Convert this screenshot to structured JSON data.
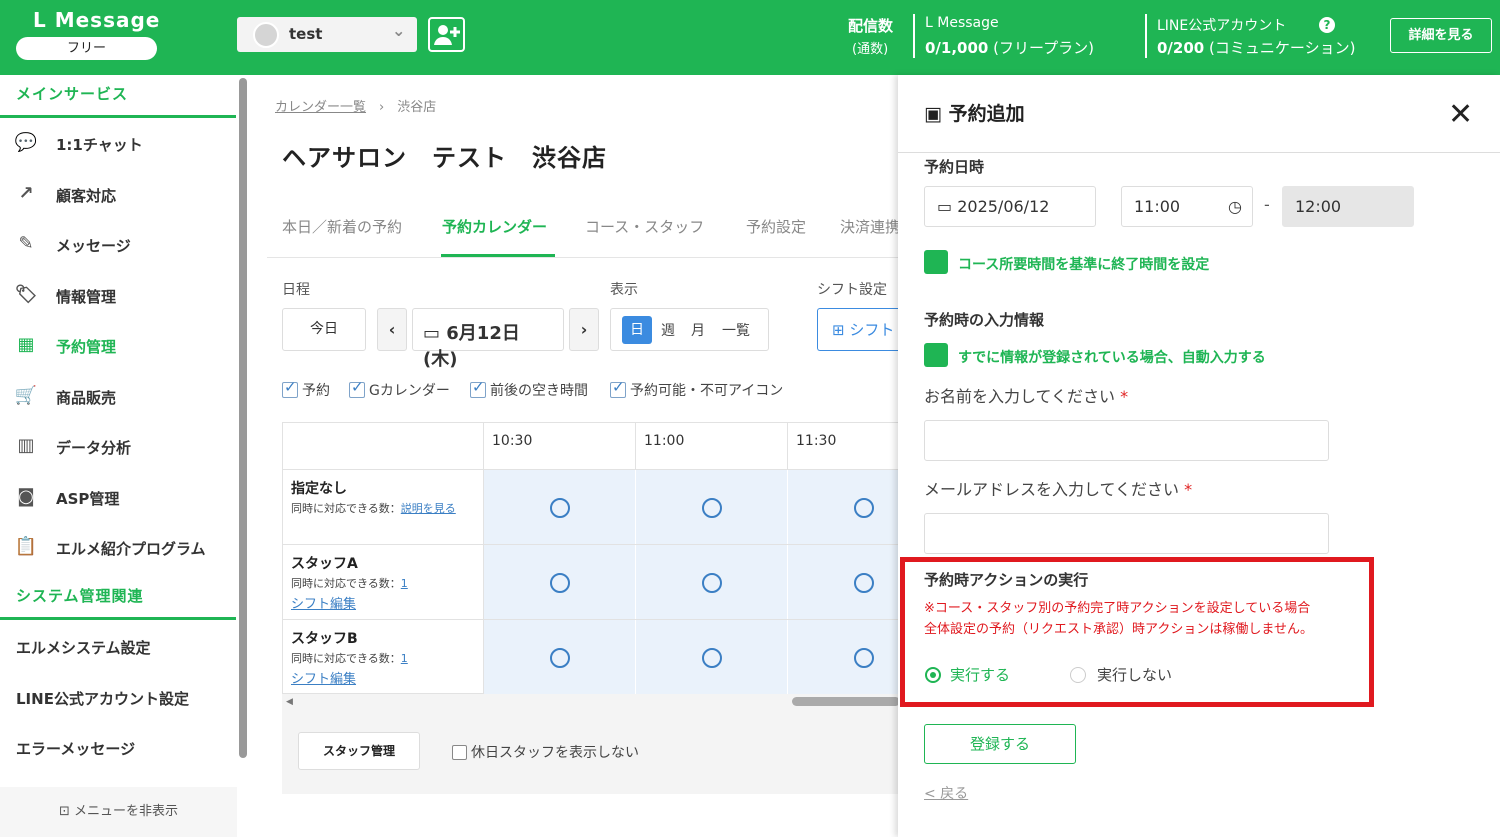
{
  "header": {
    "logo": "L Message",
    "plan": "フリー",
    "account_name": "test",
    "delivery_label": "配信数",
    "delivery_sub": "(通数)",
    "lm_title": "L Message",
    "lm_count": "0/1,000",
    "lm_plan": "(フリープラン)",
    "line_title": "LINE公式アカウント",
    "line_count": "0/200",
    "line_plan": "(コミュニケーション)",
    "detail_btn": "詳細を見る"
  },
  "sidebar": {
    "main_section": "メインサービス",
    "items": [
      {
        "label": "1:1チャット",
        "icon": "chat-icon"
      },
      {
        "label": "顧客対応",
        "icon": "arrow-icon"
      },
      {
        "label": "メッセージ",
        "icon": "edit-icon"
      },
      {
        "label": "情報管理",
        "icon": "tag-icon"
      },
      {
        "label": "予約管理",
        "icon": "calendar-icon"
      },
      {
        "label": "商品販売",
        "icon": "cart-icon"
      },
      {
        "label": "データ分析",
        "icon": "chart-icon"
      },
      {
        "label": "ASP管理",
        "icon": "asp-icon"
      },
      {
        "label": "エルメ紹介プログラム",
        "icon": "clipboard-icon"
      }
    ],
    "system_section": "システム管理関連",
    "system_items": [
      "エルメシステム設定",
      "LINE公式アカウント設定",
      "エラーメッセージ"
    ],
    "hide_menu": "メニューを非表示"
  },
  "main": {
    "breadcrumb_link": "カレンダー一覧",
    "breadcrumb_current": "渋谷店",
    "title": "ヘアサロン　テスト　渋谷店",
    "tabs": [
      "本日／新着の予約",
      "予約カレンダー",
      "コース・スタッフ",
      "予約設定",
      "決済連携"
    ],
    "schedule_label": "日程",
    "display_label": "表示",
    "shift_label": "シフト設定",
    "today_btn": "今日",
    "date": "6月12日(木)",
    "views": [
      "日",
      "週",
      "月",
      "一覧"
    ],
    "shift_btn": "シフト",
    "filters": [
      "予約",
      "Gカレンダー",
      "前後の空き時間",
      "予約可能・不可アイコン"
    ],
    "times": [
      "10:30",
      "11:00",
      "11:30"
    ],
    "rows": [
      {
        "name": "指定なし",
        "sub": "同時に対応できる数：",
        "link": "説明を見る",
        "edit": ""
      },
      {
        "name": "スタッフA",
        "sub": "同時に対応できる数：",
        "link": "1",
        "edit": "シフト編集"
      },
      {
        "name": "スタッフB",
        "sub": "同時に対応できる数：",
        "link": "1",
        "edit": "シフト編集"
      }
    ],
    "staff_btn": "スタッフ管理",
    "hide_holiday": "休日スタッフを表示しない"
  },
  "panel": {
    "title": "予約追加",
    "datetime_label": "予約日時",
    "date": "2025/06/12",
    "start": "11:00",
    "dash": "-",
    "end": "12:00",
    "auto_end": "コース所要時間を基準に終了時間を設定",
    "input_info_label": "予約時の入力情報",
    "autofill": "すでに情報が登録されている場合、自動入力する",
    "name_label": "お名前を入力してください",
    "email_label": "メールアドレスを入力してください",
    "required": "*",
    "action_label": "予約時アクションの実行",
    "note1": "※コース・スタッフ別の予約完了時アクションを設定している場合",
    "note2": "全体設定の予約（リクエスト承認）時アクションは稼働しません。",
    "opt_yes": "実行する",
    "opt_no": "実行しない",
    "register": "登録する",
    "back": "< 戻る"
  }
}
